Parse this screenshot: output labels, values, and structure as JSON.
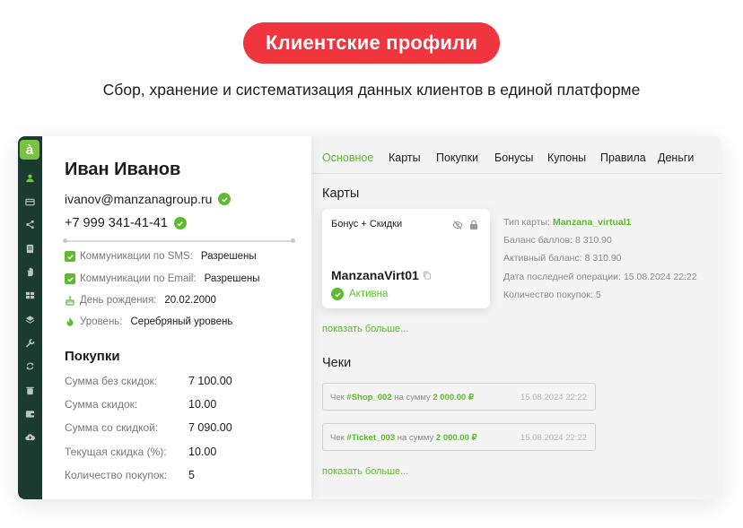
{
  "hero": {
    "title": "Клиентские профили",
    "subtitle": "Сбор, хранение и систематизация данных клиентов в единой платформе"
  },
  "logo": {
    "letter": "à"
  },
  "sidebar": {
    "icons": [
      "user-icon",
      "card-icon",
      "share-icon",
      "document-icon",
      "hand-icon",
      "grid-icon",
      "layers-icon",
      "wrench-icon",
      "refresh-icon",
      "trash-icon",
      "wallet-icon",
      "cloud-upload-icon"
    ]
  },
  "profile": {
    "name": "Иван Иванов",
    "email": "ivanov@manzanagroup.ru",
    "phone": "+7 999 341-41-41",
    "info": [
      {
        "label": "Коммуникации по SMS:",
        "value": "Разрешены"
      },
      {
        "label": "Коммуникации по Email:",
        "value": "Разрешены"
      },
      {
        "label": "День рождения:",
        "value": "20.02.2000"
      },
      {
        "label": "Уровень:",
        "value": "Серебряный уровень"
      }
    ],
    "purchases_title": "Покупки",
    "stats": [
      {
        "label": "Сумма без скидок:",
        "value": "7 100.00"
      },
      {
        "label": "Сумма скидок:",
        "value": "10.00"
      },
      {
        "label": "Сумма со скидкой:",
        "value": "7 090.00"
      },
      {
        "label": "Текущая скидка (%):",
        "value": "10.00"
      },
      {
        "label": "Количество покупок:",
        "value": "5"
      }
    ]
  },
  "tabs": [
    "Основное",
    "Карты",
    "Покупки",
    "Бонусы",
    "Купоны",
    "Правила",
    "Деньги"
  ],
  "cards_section": {
    "title": "Карты",
    "card": {
      "name": "Бонус + Скидки",
      "number": "ManzanaVirt01",
      "status": "Активна"
    },
    "meta": [
      {
        "label": "Тип карты:",
        "value": "Manzana_virtual1"
      },
      {
        "label": "Баланс баллов:",
        "value": "8 310.90"
      },
      {
        "label": "Активный баланс:",
        "value": "8 310.90"
      },
      {
        "label": "Дата последней операции:",
        "value": "15.08.2024 22:22"
      },
      {
        "label": "Количество покупок:",
        "value": "5"
      }
    ],
    "more": "показать больше..."
  },
  "receipts_section": {
    "title": "Чеки",
    "items": [
      {
        "prefix": "Чек",
        "id": "#Shop_002",
        "mid": "на сумму",
        "amount": "2 000.00 ₽",
        "date": "15.08.2024 22:22"
      },
      {
        "prefix": "Чек",
        "id": "#Ticket_003",
        "mid": "на сумму",
        "amount": "2 000.00 ₽",
        "date": "15.08.2024 22:22"
      }
    ],
    "more": "показать больше..."
  },
  "colors": {
    "accent": "#5dbb2e",
    "hero": "#f0353f",
    "sidebar": "#1b3a30"
  }
}
